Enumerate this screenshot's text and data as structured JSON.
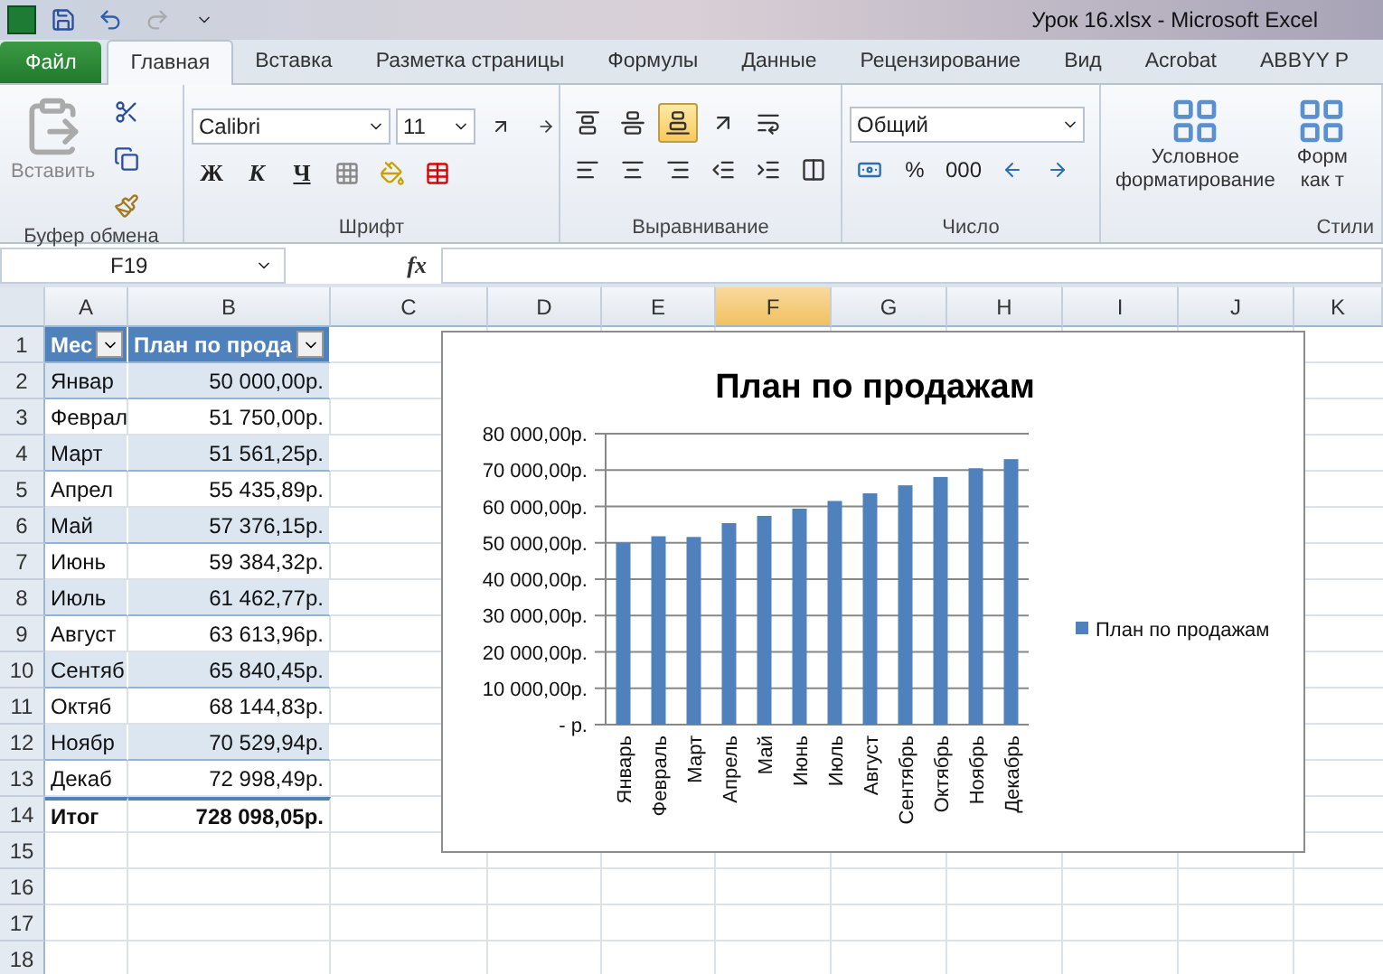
{
  "title_bar": {
    "title": "Урок 16.xlsx  -  Microsoft Excel"
  },
  "tabs": [
    {
      "label": "Файл",
      "kind": "file",
      "selected": false
    },
    {
      "label": "Главная",
      "kind": "tab",
      "selected": true
    },
    {
      "label": "Вставка",
      "kind": "tab",
      "selected": false
    },
    {
      "label": "Разметка страницы",
      "kind": "tab",
      "selected": false
    },
    {
      "label": "Формулы",
      "kind": "tab",
      "selected": false
    },
    {
      "label": "Данные",
      "kind": "tab",
      "selected": false
    },
    {
      "label": "Рецензирование",
      "kind": "tab",
      "selected": false
    },
    {
      "label": "Вид",
      "kind": "tab",
      "selected": false
    },
    {
      "label": "Acrobat",
      "kind": "tab",
      "selected": false
    },
    {
      "label": "ABBYY P",
      "kind": "tab",
      "selected": false
    }
  ],
  "ribbon": {
    "clipboard": {
      "paste_label": "Вставить",
      "group_label": "Буфер обмена"
    },
    "font": {
      "font_name": "Calibri",
      "font_size": "11",
      "bold_label": "Ж",
      "italic_label": "К",
      "underline_label": "Ч",
      "group_label": "Шрифт"
    },
    "alignment": {
      "group_label": "Выравнивание",
      "buttons": [
        {
          "kind": "top",
          "selected": false
        },
        {
          "kind": "middle",
          "selected": false
        },
        {
          "kind": "bottom",
          "selected": true
        },
        {
          "kind": "orientation",
          "selected": false
        },
        {
          "kind": "left",
          "selected": false
        },
        {
          "kind": "center",
          "selected": false
        },
        {
          "kind": "right",
          "selected": false
        },
        {
          "kind": "outdent",
          "selected": false
        },
        {
          "kind": "indent",
          "selected": false
        }
      ]
    },
    "number": {
      "format": "Общий",
      "percent_label": "%",
      "thousands_label": "000",
      "group_label": "Число"
    },
    "styles": {
      "items": [
        {
          "line1": "Условное",
          "line2": "форматирование"
        },
        {
          "line1": "Форм",
          "line2": "как т"
        }
      ],
      "group_label": "Стили"
    }
  },
  "formula_bar": {
    "name_box": "F19",
    "fx_label": "fx"
  },
  "sheet": {
    "columns": [
      {
        "label": "A",
        "selected": false
      },
      {
        "label": "B",
        "selected": false
      },
      {
        "label": "C",
        "selected": false
      },
      {
        "label": "D",
        "selected": false
      },
      {
        "label": "E",
        "selected": false
      },
      {
        "label": "F",
        "selected": true
      },
      {
        "label": "G",
        "selected": false
      },
      {
        "label": "H",
        "selected": false
      },
      {
        "label": "I",
        "selected": false
      },
      {
        "label": "J",
        "selected": false
      },
      {
        "label": "K",
        "selected": false
      }
    ],
    "rows": [
      {
        "number": "1",
        "kind": "header",
        "cells": [
          "Мес",
          "План по прода"
        ]
      },
      {
        "number": "2",
        "kind": "data",
        "cells": [
          "Январ",
          "50 000,00р."
        ]
      },
      {
        "number": "3",
        "kind": "data",
        "cells": [
          "Феврал",
          "51 750,00р."
        ]
      },
      {
        "number": "4",
        "kind": "data",
        "cells": [
          "Март",
          "51 561,25р."
        ]
      },
      {
        "number": "5",
        "kind": "data",
        "cells": [
          "Апрел",
          "55 435,89р."
        ]
      },
      {
        "number": "6",
        "kind": "data",
        "cells": [
          "Май",
          "57 376,15р."
        ]
      },
      {
        "number": "7",
        "kind": "data",
        "cells": [
          "Июнь",
          "59 384,32р."
        ]
      },
      {
        "number": "8",
        "kind": "data",
        "cells": [
          "Июль",
          "61 462,77р."
        ]
      },
      {
        "number": "9",
        "kind": "data",
        "cells": [
          "Август",
          "63 613,96р."
        ]
      },
      {
        "number": "10",
        "kind": "data",
        "cells": [
          "Сентяб",
          "65 840,45р."
        ]
      },
      {
        "number": "11",
        "kind": "data",
        "cells": [
          "Октяб",
          "68 144,83р."
        ]
      },
      {
        "number": "12",
        "kind": "data",
        "cells": [
          "Ноябр",
          "70 529,94р."
        ]
      },
      {
        "number": "13",
        "kind": "data",
        "cells": [
          "Декаб",
          "72 998,49р."
        ]
      },
      {
        "number": "14",
        "kind": "total",
        "cells": [
          "Итог",
          "728 098,05р."
        ]
      },
      {
        "number": "15",
        "kind": "empty",
        "cells": []
      },
      {
        "number": "16",
        "kind": "empty",
        "cells": []
      },
      {
        "number": "17",
        "kind": "empty",
        "cells": []
      },
      {
        "number": "18",
        "kind": "empty",
        "cells": []
      }
    ]
  },
  "chart": {
    "chart_data": {
      "type": "bar",
      "title": "План по продажам",
      "categories": [
        "Январь",
        "Февраль",
        "Март",
        "Апрель",
        "Май",
        "Июнь",
        "Июль",
        "Август",
        "Сентябрь",
        "Октябрь",
        "Ноябрь",
        "Декабрь"
      ],
      "series": [
        {
          "name": "План по продажам",
          "color": "#4f81bd",
          "values": [
            50000,
            51800,
            51600,
            55400,
            57400,
            59400,
            61500,
            63600,
            65800,
            68100,
            70500,
            73000
          ]
        }
      ],
      "grid": true,
      "ylim": [
        0,
        80000
      ],
      "yticks": [
        {
          "value": 0,
          "label": "-  р."
        },
        {
          "value": 10000,
          "label": "10 000,00р."
        },
        {
          "value": 20000,
          "label": "20 000,00р."
        },
        {
          "value": 30000,
          "label": "30 000,00р."
        },
        {
          "value": 40000,
          "label": "40 000,00р."
        },
        {
          "value": 50000,
          "label": "50 000,00р."
        },
        {
          "value": 60000,
          "label": "60 000,00р."
        },
        {
          "value": 70000,
          "label": "70 000,00р."
        },
        {
          "value": 80000,
          "label": "80 000,00р."
        }
      ]
    }
  }
}
